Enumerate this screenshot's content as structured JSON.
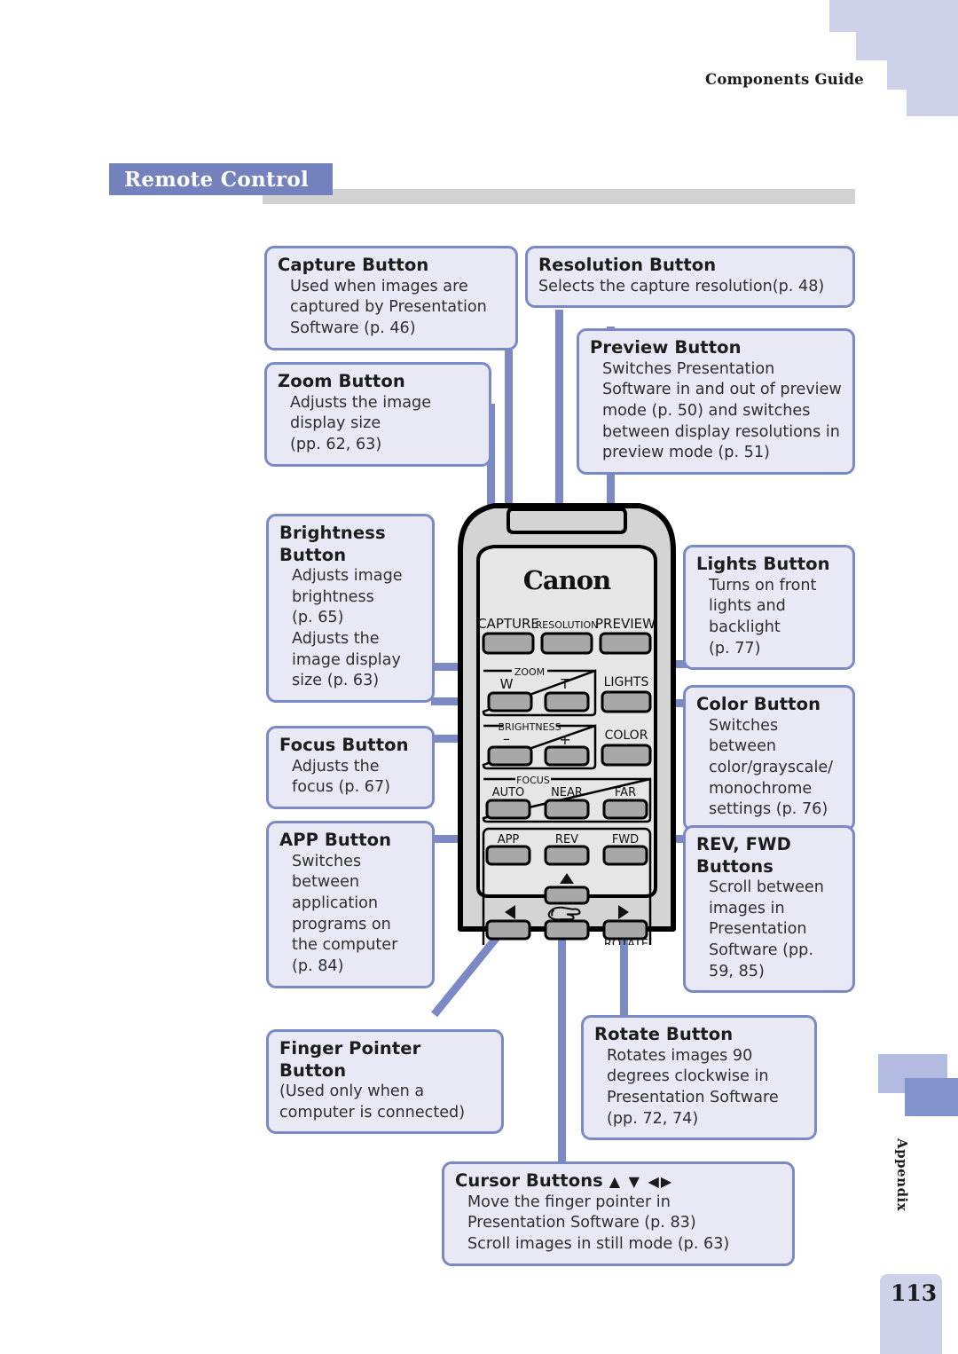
{
  "header": {
    "running_head": "Components Guide"
  },
  "section": {
    "title": "Remote Control"
  },
  "footer": {
    "tab_label": "Appendix",
    "page_number": "113"
  },
  "device": {
    "brand": "Canon",
    "buttons": {
      "capture": "CAPTURE",
      "resolution": "RESOLUTION",
      "preview": "PREVIEW",
      "zoom_group": "ZOOM",
      "zoom_wide": "W",
      "zoom_tele": "T",
      "lights": "LIGHTS",
      "brightness_group": "BRIGHTNESS",
      "brightness_minus": "–",
      "brightness_plus": "+",
      "color": "COLOR",
      "focus_group": "FOCUS",
      "focus_auto": "AUTO",
      "focus_near": "NEAR",
      "focus_far": "FAR",
      "app": "APP",
      "rev": "REV",
      "fwd": "FWD",
      "rotate": "ROTATE",
      "cursor_up": "▲",
      "cursor_down": "▼",
      "cursor_left": "◀",
      "cursor_right": "▶",
      "finger_pointer": "finger-pointer-glyph"
    }
  },
  "callouts": {
    "capture": {
      "title": "Capture Button",
      "body": "Used when images are\ncaptured by Presentation\nSoftware (p. 46)"
    },
    "zoom": {
      "title": "Zoom Button",
      "body": "Adjusts the image\ndisplay size\n(pp. 62, 63)"
    },
    "brightness": {
      "title": "Brightness\nButton",
      "body": "Adjusts image\nbrightness\n(p. 65)\nAdjusts the\nimage display\nsize (p. 63)"
    },
    "focus": {
      "title": "Focus Button",
      "body": "Adjusts the\nfocus (p. 67)"
    },
    "app": {
      "title": "APP Button",
      "body": "Switches\nbetween\napplication\nprograms on\nthe computer\n(p. 84)"
    },
    "finger": {
      "title": "Finger Pointer Button",
      "body": "(Used only when a\n   computer is connected)"
    },
    "resolution": {
      "title": "Resolution Button",
      "body": "Selects the capture resolution(p. 48)"
    },
    "preview": {
      "title": "Preview Button",
      "body": "Switches Presentation\nSoftware in and out of preview\nmode (p. 50) and switches\nbetween display resolutions in\npreview mode (p. 51)"
    },
    "lights": {
      "title": "Lights Button",
      "body": "Turns on front\nlights and\nbacklight\n(p. 77)"
    },
    "color": {
      "title": "Color Button",
      "body": "Switches between\ncolor/grayscale/\nmonochrome\nsettings (p. 76)"
    },
    "revfwd": {
      "title": "REV, FWD\nButtons",
      "body": "Scroll between\nimages in\nPresentation\nSoftware (pp.\n59, 85)"
    },
    "rotate": {
      "title": "Rotate Button",
      "body": "Rotates images 90\ndegrees clockwise in\nPresentation Software\n(pp. 72, 74)"
    },
    "cursor": {
      "title": "Cursor Buttons ",
      "title_arrows": "▲ ▼ ◀▶",
      "body": "Move the finger pointer in\nPresentation Software (p. 83)\nScroll images in still mode (p. 63)"
    }
  },
  "colors": {
    "accent": "#7382bd",
    "callout_border": "#7b8ac4",
    "callout_fill": "#e9e9f6",
    "rule": "#d2d2d2",
    "tab_light": "#b3bce0",
    "tab_dark": "#8292cc",
    "page_box": "#cdd2ea"
  }
}
